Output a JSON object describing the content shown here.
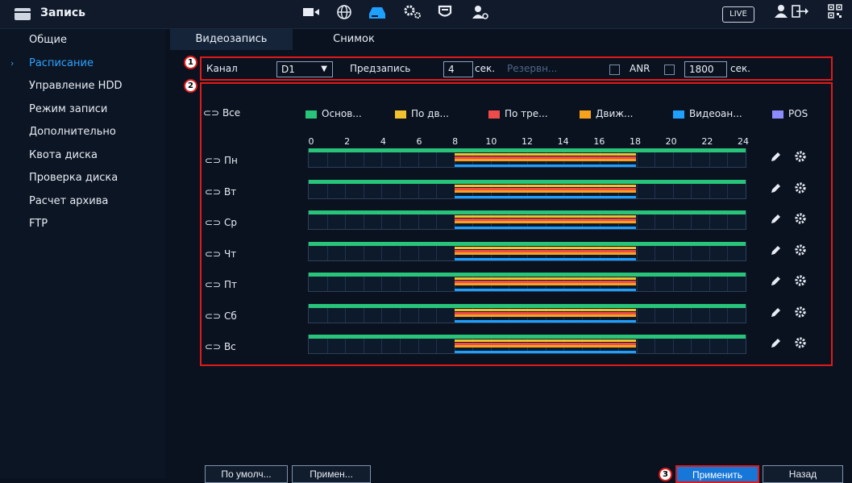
{
  "header": {
    "title": "Запись",
    "icons": [
      "camera-icon",
      "network-icon",
      "storage-icon",
      "system-gear-icon",
      "shield-icon",
      "account-icon"
    ],
    "live_label": "LIVE",
    "right_icons": [
      "user-icon",
      "logout-icon",
      "qr-icon"
    ]
  },
  "sidebar": {
    "items": [
      {
        "label": "Общие"
      },
      {
        "label": "Расписание"
      },
      {
        "label": "Управление HDD"
      },
      {
        "label": "Режим записи"
      },
      {
        "label": "Дополнительно"
      },
      {
        "label": "Квота диска"
      },
      {
        "label": "Проверка диска"
      },
      {
        "label": "Расчет архива"
      },
      {
        "label": "FTP"
      }
    ],
    "active_item": "Расписание",
    "arrow": "›"
  },
  "tabs": {
    "video": "Видеозапись",
    "snapshot": "Снимок"
  },
  "controls": {
    "channel_label": "Канал",
    "channel_value": "D1",
    "prerecord_label": "Предзапись",
    "prerecord_value": "4",
    "prerecord_unit": "сек.",
    "redundancy_label": "Резервн...",
    "anr_label": "ANR",
    "anr_value": "1800",
    "anr_unit": "сек."
  },
  "schedule": {
    "all_label": "Все",
    "legend": [
      {
        "label": "Основ...",
        "color": "#27c47a"
      },
      {
        "label": "По дв...",
        "color": "#f2c12e"
      },
      {
        "label": "По тре...",
        "color": "#f04b4b"
      },
      {
        "label": "Движ...",
        "color": "#f7a21b"
      },
      {
        "label": "Видеоан...",
        "color": "#1ea0ff"
      },
      {
        "label": "POS",
        "color": "#8c8cff"
      }
    ],
    "hours": [
      "0",
      "2",
      "4",
      "6",
      "8",
      "10",
      "12",
      "14",
      "16",
      "18",
      "20",
      "22",
      "24"
    ],
    "days": [
      "Пн",
      "Вт",
      "Ср",
      "Чт",
      "Пт",
      "Сб",
      "Вс"
    ],
    "ranges_hours": [
      {
        "type": "Основ...",
        "start": 0,
        "end": 24
      },
      {
        "type": "По дв...",
        "start": 8,
        "end": 18
      },
      {
        "type": "По тре...",
        "start": 8,
        "end": 18
      },
      {
        "type": "Движ...",
        "start": 8,
        "end": 18
      },
      {
        "type": "Видеоан...",
        "start": 8,
        "end": 18
      }
    ],
    "row_icons": [
      "edit-pen-icon",
      "settings-gear-icon"
    ]
  },
  "badges": [
    "1",
    "2",
    "3"
  ],
  "footer": {
    "default_label": "По умолч...",
    "copy_label": "Примен...",
    "apply_label": "Применить",
    "back_label": "Назад"
  }
}
